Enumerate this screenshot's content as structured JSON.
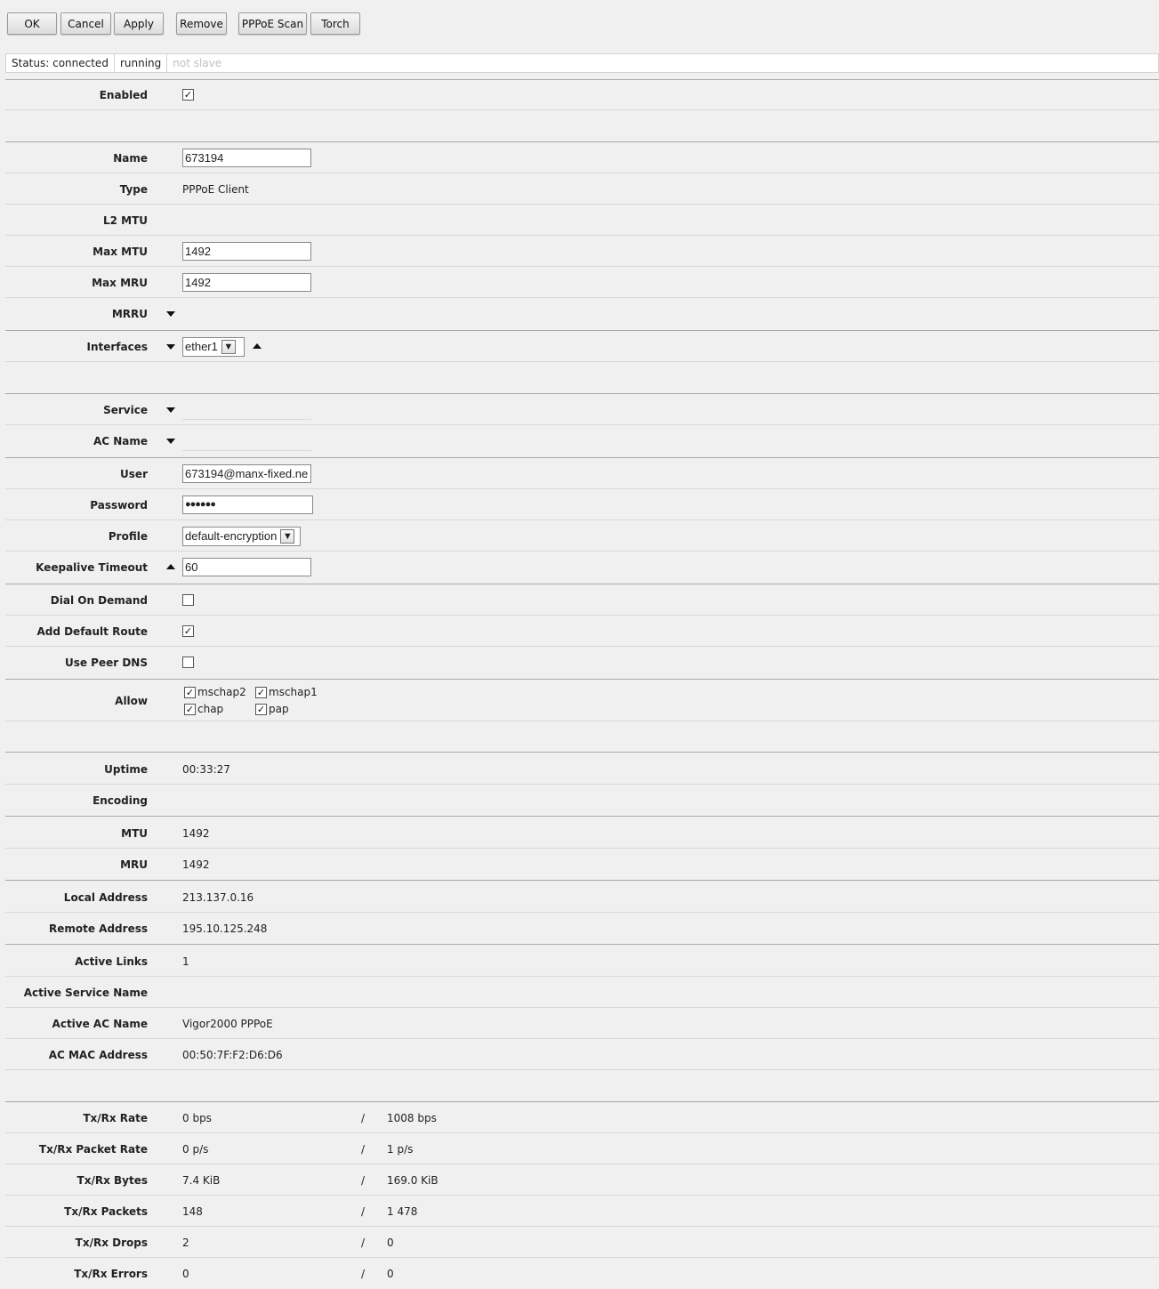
{
  "toolbar": {
    "ok": "OK",
    "cancel": "Cancel",
    "apply": "Apply",
    "remove": "Remove",
    "pppoe_scan": "PPPoE Scan",
    "torch": "Torch"
  },
  "status": {
    "connected": "Status: connected",
    "running": "running",
    "slave": "not slave"
  },
  "form": {
    "enabled": {
      "label": "Enabled",
      "checked": true
    },
    "name": {
      "label": "Name",
      "value": "673194"
    },
    "type": {
      "label": "Type",
      "value": "PPPoE Client"
    },
    "l2mtu": {
      "label": "L2 MTU"
    },
    "max_mtu": {
      "label": "Max MTU",
      "value": "1492"
    },
    "max_mru": {
      "label": "Max MRU",
      "value": "1492"
    },
    "mrru": {
      "label": "MRRU"
    },
    "interfaces": {
      "label": "Interfaces",
      "value": "ether1"
    },
    "service": {
      "label": "Service"
    },
    "ac_name": {
      "label": "AC Name"
    },
    "user": {
      "label": "User",
      "value": "673194@manx-fixed.ne"
    },
    "password": {
      "label": "Password",
      "value": "●●●●●●"
    },
    "profile": {
      "label": "Profile",
      "value": "default-encryption"
    },
    "keepalive": {
      "label": "Keepalive Timeout",
      "value": "60"
    },
    "dial_on_demand": {
      "label": "Dial On Demand",
      "checked": false
    },
    "add_default_route": {
      "label": "Add Default Route",
      "checked": true
    },
    "use_peer_dns": {
      "label": "Use Peer DNS",
      "checked": false
    },
    "allow": {
      "label": "Allow",
      "options": [
        {
          "name": "mschap2",
          "checked": true
        },
        {
          "name": "mschap1",
          "checked": true
        },
        {
          "name": "chap",
          "checked": true
        },
        {
          "name": "pap",
          "checked": true
        }
      ]
    }
  },
  "info": {
    "uptime": {
      "label": "Uptime",
      "value": "00:33:27"
    },
    "encoding": {
      "label": "Encoding",
      "value": ""
    },
    "mtu": {
      "label": "MTU",
      "value": "1492"
    },
    "mru": {
      "label": "MRU",
      "value": "1492"
    },
    "local_address": {
      "label": "Local Address",
      "value": "213.137.0.16"
    },
    "remote_address": {
      "label": "Remote Address",
      "value": "195.10.125.248"
    },
    "active_links": {
      "label": "Active Links",
      "value": "1"
    },
    "active_service_name": {
      "label": "Active Service Name",
      "value": ""
    },
    "active_ac_name": {
      "label": "Active AC Name",
      "value": "Vigor2000 PPPoE"
    },
    "ac_mac_address": {
      "label": "AC MAC Address",
      "value": "00:50:7F:F2:D6:D6"
    }
  },
  "stats": {
    "slash": "/",
    "rows": [
      {
        "label": "Tx/Rx Rate",
        "tx": "0 bps",
        "rx": "1008 bps"
      },
      {
        "label": "Tx/Rx Packet Rate",
        "tx": "0 p/s",
        "rx": "1 p/s"
      },
      {
        "label": "Tx/Rx Bytes",
        "tx": "7.4 KiB",
        "rx": "169.0 KiB"
      },
      {
        "label": "Tx/Rx Packets",
        "tx": "148",
        "rx": "1 478"
      },
      {
        "label": "Tx/Rx Drops",
        "tx": "2",
        "rx": "0"
      },
      {
        "label": "Tx/Rx Errors",
        "tx": "0",
        "rx": "0"
      }
    ]
  }
}
